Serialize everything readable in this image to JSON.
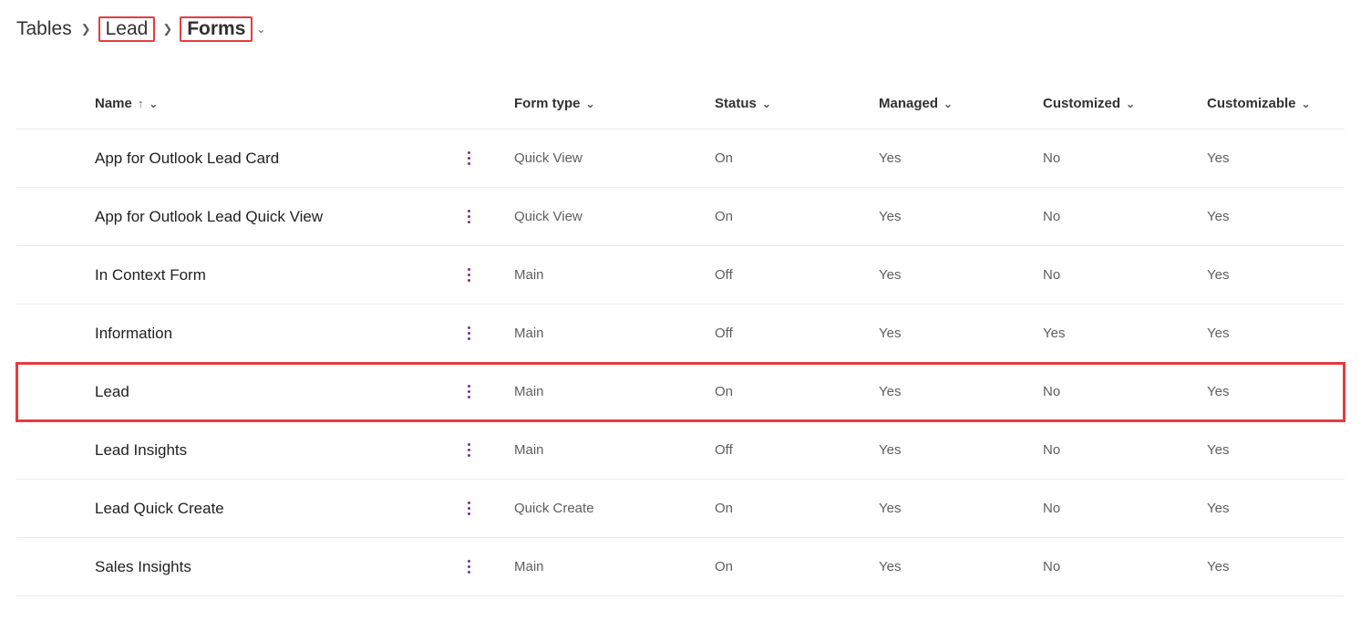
{
  "breadcrumb": {
    "items": [
      {
        "label": "Tables",
        "highlight": false,
        "current": false
      },
      {
        "label": "Lead",
        "highlight": true,
        "current": false
      },
      {
        "label": "Forms",
        "highlight": true,
        "current": true
      }
    ]
  },
  "columns": {
    "name": {
      "label": "Name",
      "sorted_asc": true
    },
    "form_type": {
      "label": "Form type"
    },
    "status": {
      "label": "Status"
    },
    "managed": {
      "label": "Managed"
    },
    "customized": {
      "label": "Customized"
    },
    "customizable": {
      "label": "Customizable"
    }
  },
  "rows": [
    {
      "name": "App for Outlook Lead Card",
      "form_type": "Quick View",
      "status": "On",
      "managed": "Yes",
      "customized": "No",
      "customizable": "Yes",
      "highlight": false
    },
    {
      "name": "App for Outlook Lead Quick View",
      "form_type": "Quick View",
      "status": "On",
      "managed": "Yes",
      "customized": "No",
      "customizable": "Yes",
      "highlight": false
    },
    {
      "name": "In Context Form",
      "form_type": "Main",
      "status": "Off",
      "managed": "Yes",
      "customized": "No",
      "customizable": "Yes",
      "highlight": false
    },
    {
      "name": "Information",
      "form_type": "Main",
      "status": "Off",
      "managed": "Yes",
      "customized": "Yes",
      "customizable": "Yes",
      "highlight": false
    },
    {
      "name": "Lead",
      "form_type": "Main",
      "status": "On",
      "managed": "Yes",
      "customized": "No",
      "customizable": "Yes",
      "highlight": true
    },
    {
      "name": "Lead Insights",
      "form_type": "Main",
      "status": "Off",
      "managed": "Yes",
      "customized": "No",
      "customizable": "Yes",
      "highlight": false
    },
    {
      "name": "Lead Quick Create",
      "form_type": "Quick Create",
      "status": "On",
      "managed": "Yes",
      "customized": "No",
      "customizable": "Yes",
      "highlight": false
    },
    {
      "name": "Sales Insights",
      "form_type": "Main",
      "status": "On",
      "managed": "Yes",
      "customized": "No",
      "customizable": "Yes",
      "highlight": false
    }
  ]
}
